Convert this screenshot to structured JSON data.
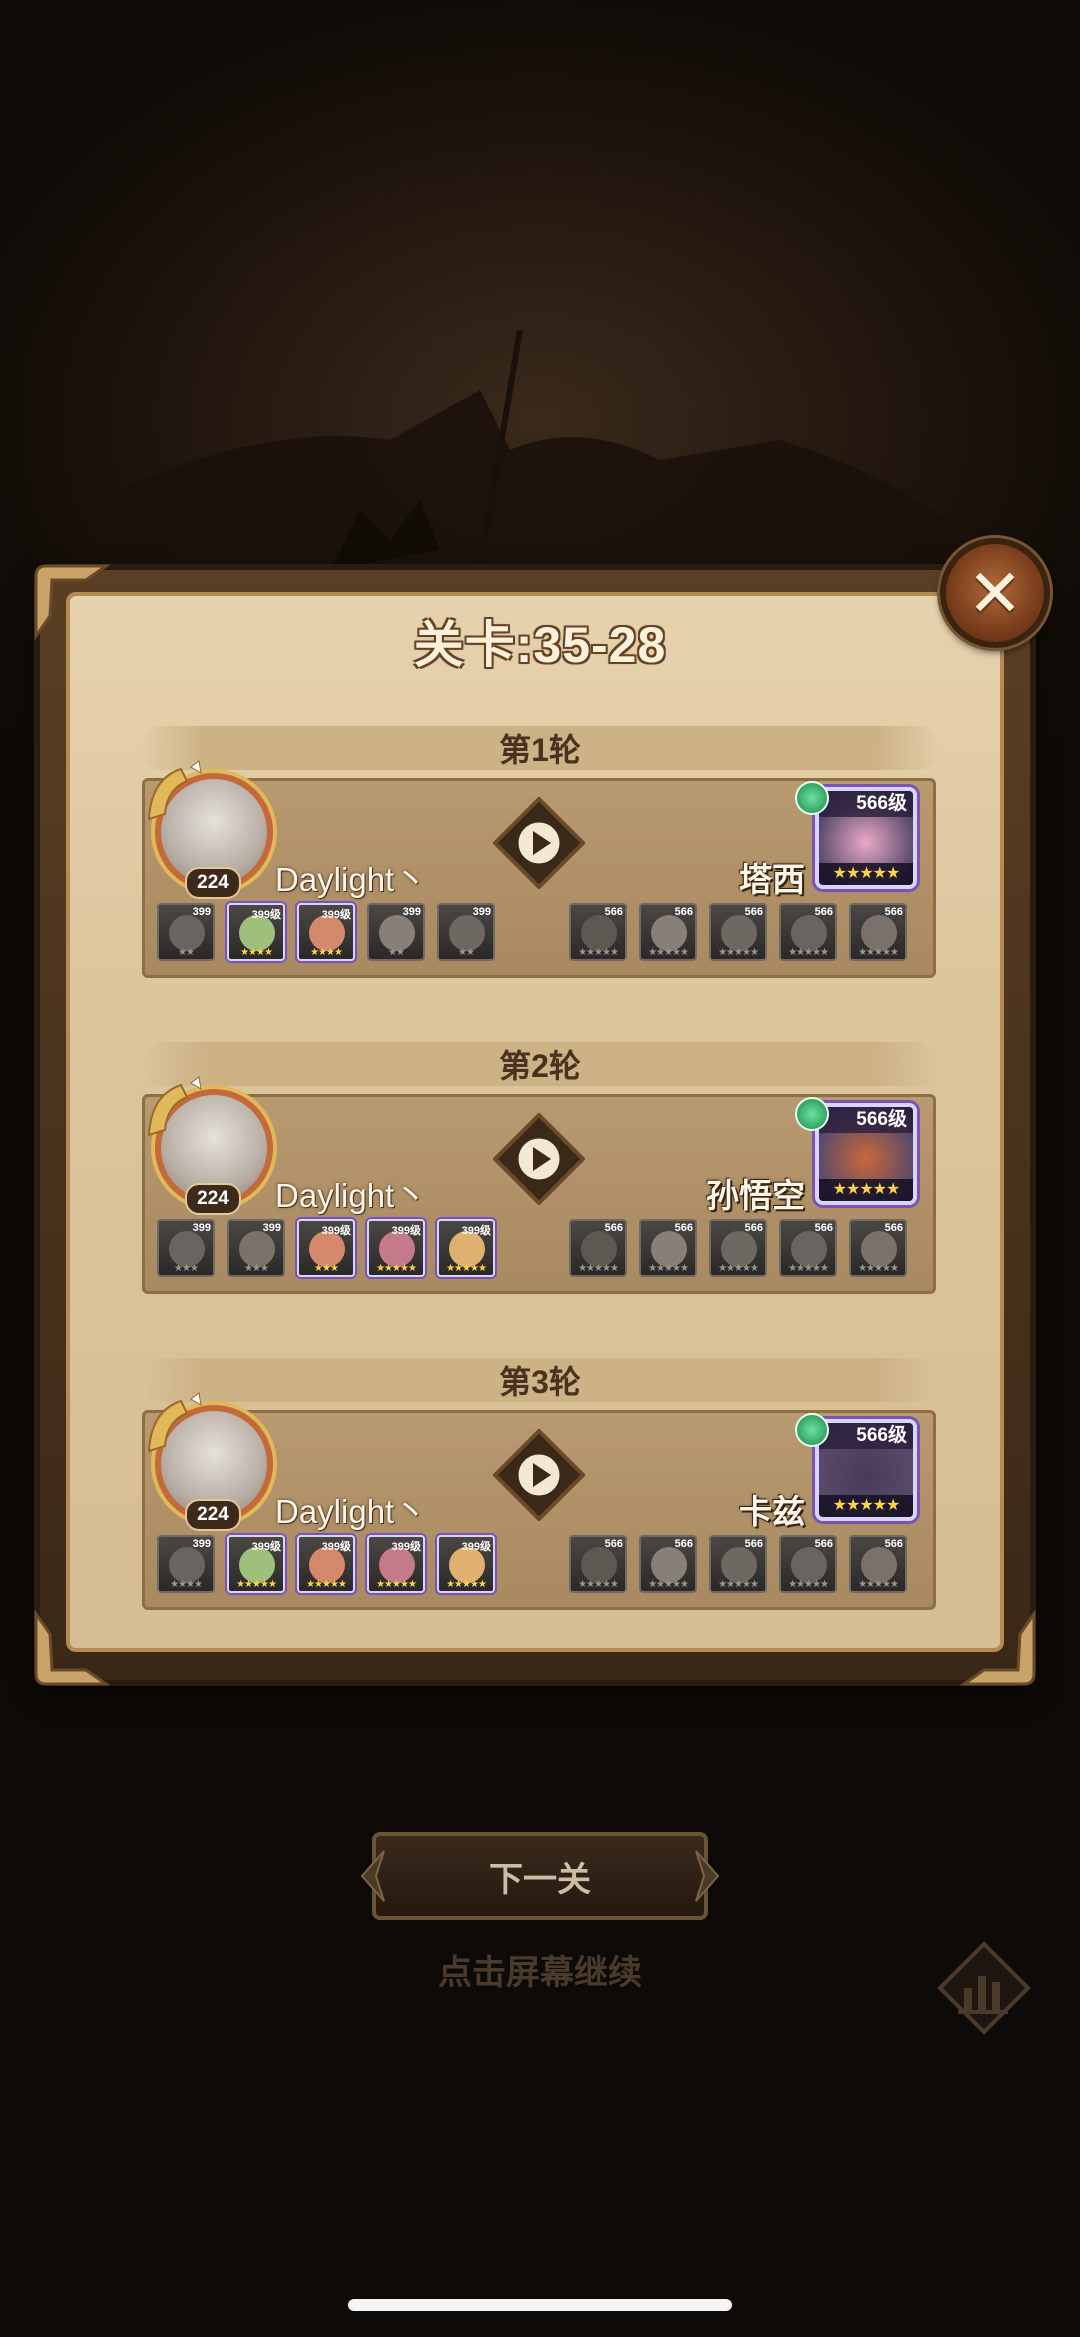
{
  "title": "关卡:35-28",
  "close_label": "✕",
  "rounds": [
    {
      "header": "第1轮",
      "player": {
        "name": "Daylight丶",
        "level": "224"
      },
      "enemy": {
        "name": "塔西",
        "level": "566级",
        "stars": "★★★★★"
      },
      "player_heroes": [
        {
          "lv": "399",
          "stars": "★★",
          "color": false
        },
        {
          "lv": "399级",
          "stars": "★★★★",
          "color": true
        },
        {
          "lv": "399级",
          "stars": "★★★★",
          "color": true
        },
        {
          "lv": "399",
          "stars": "★★",
          "color": false
        },
        {
          "lv": "399",
          "stars": "★★",
          "color": false
        }
      ],
      "enemy_heroes": [
        {
          "lv": "566",
          "stars": "★★★★★"
        },
        {
          "lv": "566",
          "stars": "★★★★★"
        },
        {
          "lv": "566",
          "stars": "★★★★★"
        },
        {
          "lv": "566",
          "stars": "★★★★★"
        },
        {
          "lv": "566",
          "stars": "★★★★★"
        }
      ]
    },
    {
      "header": "第2轮",
      "player": {
        "name": "Daylight丶",
        "level": "224"
      },
      "enemy": {
        "name": "孙悟空",
        "level": "566级",
        "stars": "★★★★★"
      },
      "player_heroes": [
        {
          "lv": "399",
          "stars": "★★★",
          "color": false
        },
        {
          "lv": "399",
          "stars": "★★★",
          "color": false
        },
        {
          "lv": "399级",
          "stars": "★★★",
          "color": true
        },
        {
          "lv": "399级",
          "stars": "★★★★★",
          "color": true
        },
        {
          "lv": "399级",
          "stars": "★★★★★",
          "color": true
        }
      ],
      "enemy_heroes": [
        {
          "lv": "566",
          "stars": "★★★★★"
        },
        {
          "lv": "566",
          "stars": "★★★★★"
        },
        {
          "lv": "566",
          "stars": "★★★★★"
        },
        {
          "lv": "566",
          "stars": "★★★★★"
        },
        {
          "lv": "566",
          "stars": "★★★★★"
        }
      ]
    },
    {
      "header": "第3轮",
      "player": {
        "name": "Daylight丶",
        "level": "224"
      },
      "enemy": {
        "name": "卡兹",
        "level": "566级",
        "stars": "★★★★★"
      },
      "player_heroes": [
        {
          "lv": "399",
          "stars": "★★★★",
          "color": false
        },
        {
          "lv": "399级",
          "stars": "★★★★★",
          "color": true
        },
        {
          "lv": "399级",
          "stars": "★★★★★",
          "color": true
        },
        {
          "lv": "399级",
          "stars": "★★★★★",
          "color": true
        },
        {
          "lv": "399级",
          "stars": "★★★★★",
          "color": true
        }
      ],
      "enemy_heroes": [
        {
          "lv": "566",
          "stars": "★★★★★"
        },
        {
          "lv": "566",
          "stars": "★★★★★"
        },
        {
          "lv": "566",
          "stars": "★★★★★"
        },
        {
          "lv": "566",
          "stars": "★★★★★"
        },
        {
          "lv": "566",
          "stars": "★★★★★"
        }
      ]
    }
  ],
  "next_button": "下一关",
  "tap_hint": "点击屏幕继续",
  "colors": {
    "parchment": "#e0c9a2",
    "frame": "#5a3f24",
    "panel": "#b0916a",
    "close_btn": "#7a3e1c",
    "enemy_border": "#7a54b5"
  },
  "icons": {
    "close": "close-icon",
    "play": "play-icon",
    "stats": "bar-chart-icon"
  }
}
